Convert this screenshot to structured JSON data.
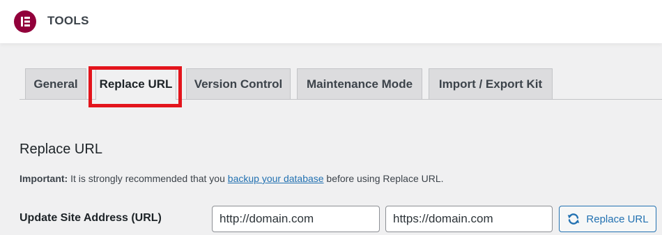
{
  "header": {
    "title": "TOOLS",
    "logo_icon": "elementor-logo-icon",
    "logo_color": "#92003b"
  },
  "tabs": [
    {
      "label": "General",
      "active": false
    },
    {
      "label": "Replace URL",
      "active": true
    },
    {
      "label": "Version Control",
      "active": false
    },
    {
      "label": "Maintenance Mode",
      "active": false
    },
    {
      "label": "Import / Export Kit",
      "active": false
    }
  ],
  "section": {
    "title": "Replace URL",
    "notice_strong": "Important:",
    "notice_text_before": " It is strongly recommended that you ",
    "notice_link": "backup your database",
    "notice_text_after": " before using Replace URL."
  },
  "form": {
    "label": "Update Site Address (URL)",
    "old_url_value": "http://domain.com",
    "new_url_value": "https://domain.com",
    "button_label": "Replace URL",
    "button_icon": "refresh-icon"
  },
  "colors": {
    "highlight": "#e3141c",
    "link": "#2271b1"
  }
}
